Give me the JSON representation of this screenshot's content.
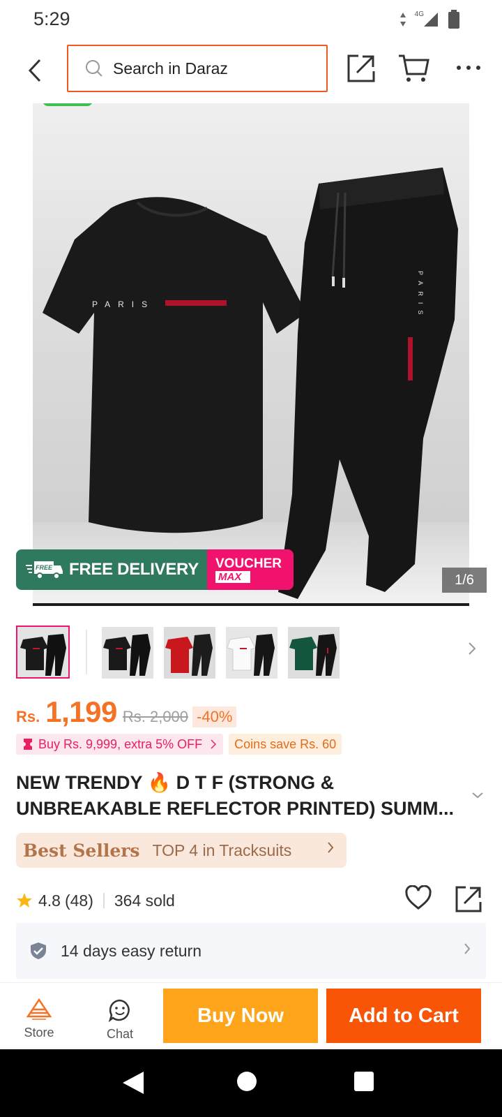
{
  "status_bar": {
    "time": "5:29",
    "network": "4G"
  },
  "header": {
    "search_placeholder": "Search in Daraz",
    "icons": [
      "back-arrow-icon",
      "search-icon",
      "share-icon",
      "cart-icon",
      "more-icon"
    ]
  },
  "gallery": {
    "counter": "1/6",
    "shirt_print": "PARIS",
    "delivery_badge": "FREE",
    "delivery_label": "FREE DELIVERY",
    "voucher_line1": "VOUCHER",
    "voucher_line2": "MAX",
    "thumbnail_variants": [
      "black-set",
      "black-set",
      "red-set",
      "white-set",
      "green-set"
    ]
  },
  "price": {
    "currency": "Rs.",
    "current": "1,199",
    "original": "Rs. 2,000",
    "discount": "-40%"
  },
  "promos": {
    "buy_more": "Buy Rs. 9,999, extra 5% OFF",
    "coins": "Coins save Rs. 60"
  },
  "product": {
    "title_part1": "NEW TRENDY",
    "title_emoji": "🔥",
    "title_part2": "D T F (STRONG & UNBREAKABLE REFLECTOR PRINTED) SUMM..."
  },
  "best_sellers": {
    "label": "Best Sellers",
    "rank": "TOP 4 in Tracksuits"
  },
  "rating": {
    "score": "4.8",
    "count": "(48)",
    "sold": "364 sold"
  },
  "return_policy": {
    "text": "14 days easy return"
  },
  "action_bar": {
    "store_label": "Store",
    "chat_label": "Chat",
    "buy_now": "Buy Now",
    "add_to_cart": "Add to Cart"
  },
  "colors": {
    "accent_orange": "#f57224",
    "buy_now_bg": "#fea51c",
    "add_cart_bg": "#f85606",
    "search_border": "#f05a22"
  }
}
